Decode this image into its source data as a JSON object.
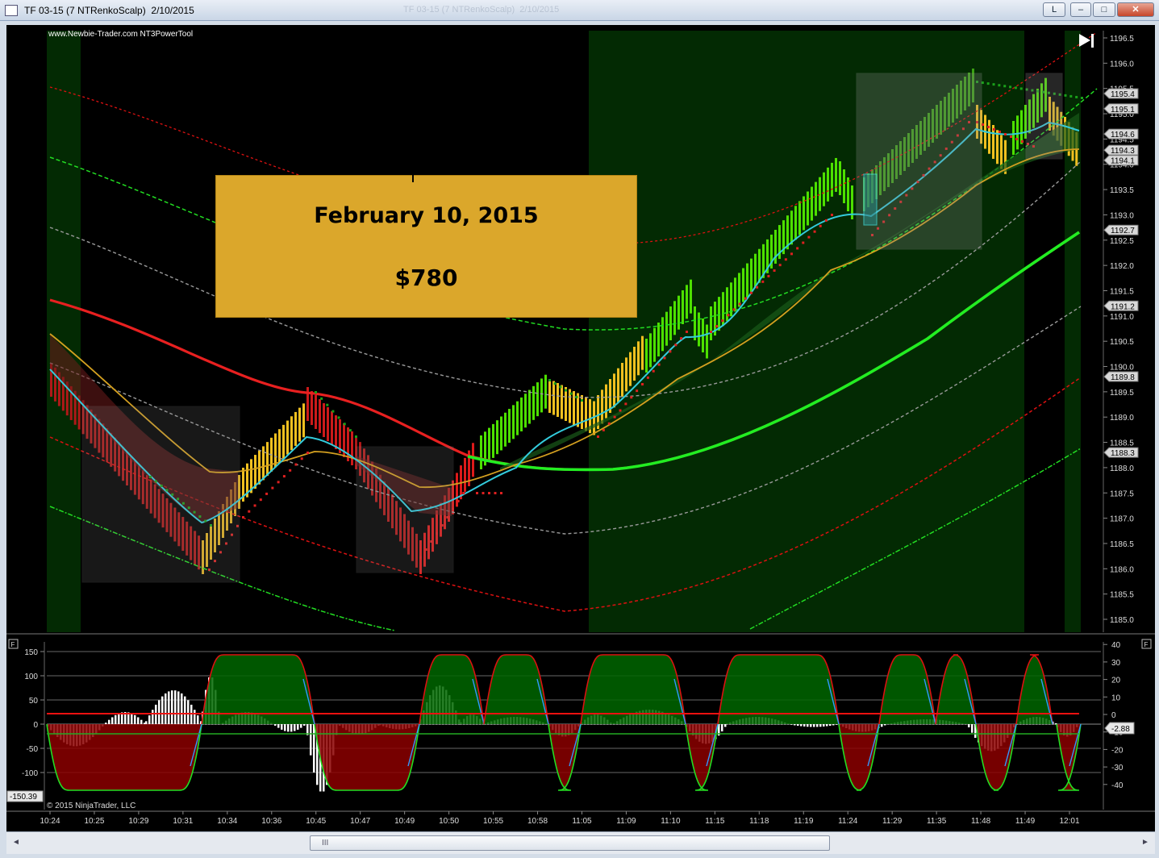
{
  "window": {
    "title": "TF 03-15 (7 NTRenkoScalp)  2/10/2015",
    "ghost_title": "TF 03-15 (7 NTRenkoScalp)  2/10/2015",
    "buttons": {
      "layout_label": "L",
      "minimize": "–",
      "maximize": "□",
      "close": "✕"
    }
  },
  "chart": {
    "watermark": "www.Newbie-Trader.com NT3PowerTool",
    "copyright": "© 2015 NinjaTrader, LLC",
    "panel_flag_left": "F",
    "panel_flag_right": "F",
    "play_icon": "skip-to-end-icon",
    "price_axis_ticks": [
      "1196.5",
      "1196.0",
      "1195.5",
      "1195.0",
      "1194.5",
      "1194.0",
      "1193.5",
      "1193.0",
      "1192.5",
      "1192.0",
      "1191.5",
      "1191.0",
      "1190.5",
      "1190.0",
      "1189.5",
      "1189.0",
      "1188.5",
      "1188.0",
      "1187.5",
      "1187.0",
      "1186.5",
      "1186.0",
      "1185.5",
      "1185.0"
    ],
    "price_axis_range": [
      1184.9,
      1196.7
    ],
    "price_flags": [
      {
        "label": "1195.4",
        "value": 1195.4,
        "color": "#b0b0b0"
      },
      {
        "label": "1195.1",
        "value": 1195.1,
        "color": "#b0b0b0"
      },
      {
        "label": "1194.6",
        "value": 1194.6,
        "color": "#b0b0b0"
      },
      {
        "label": "1194.3",
        "value": 1194.28,
        "color": "#b0b0b0"
      },
      {
        "label": "1194.1",
        "value": 1194.08,
        "color": "#b0b0b0"
      },
      {
        "label": "1192.7",
        "value": 1192.7,
        "color": "#b0b0b0"
      },
      {
        "label": "1191.2",
        "value": 1191.2,
        "color": "#b0b0b0"
      },
      {
        "label": "1189.8",
        "value": 1189.8,
        "color": "#b0b0b0"
      },
      {
        "label": "1188.3",
        "value": 1188.3,
        "color": "#b0b0b0"
      }
    ],
    "osc_left_ticks": [
      "150",
      "100",
      "50",
      "0",
      "-50",
      "-100"
    ],
    "osc_left_values": [
      150,
      100,
      50,
      0,
      -50,
      -100
    ],
    "osc_left_range": [
      -180,
      165
    ],
    "osc_left_flag": "-150.39",
    "osc_right_ticks": [
      "40",
      "30",
      "20",
      "10",
      "0",
      "-10",
      "-20",
      "-30",
      "-40"
    ],
    "osc_right_values": [
      40,
      30,
      20,
      10,
      0,
      -10,
      -20,
      -30,
      -40
    ],
    "osc_right_flag": "-2.88",
    "time_labels": [
      "10:24",
      "10:25",
      "10:29",
      "10:31",
      "10:34",
      "10:36",
      "10:45",
      "10:47",
      "10:49",
      "10:50",
      "10:55",
      "10:58",
      "11:05",
      "11:09",
      "11:10",
      "11:15",
      "11:18",
      "11:19",
      "11:24",
      "11:29",
      "11:35",
      "11:48",
      "11:49",
      "12:01"
    ],
    "colors": {
      "up": "#4de000",
      "down": "#cc1a1a",
      "neutral": "#f0c020",
      "ema": "#d4a020",
      "fast": "#33ccdd",
      "band_red": "#ff1a1a",
      "band_green": "#22ee22"
    }
  },
  "banner": {
    "date": "February 10, 2015",
    "amount": "$780"
  },
  "scrollbar": {
    "grip": "III",
    "left_arrow": "◄",
    "right_arrow": "►"
  }
}
